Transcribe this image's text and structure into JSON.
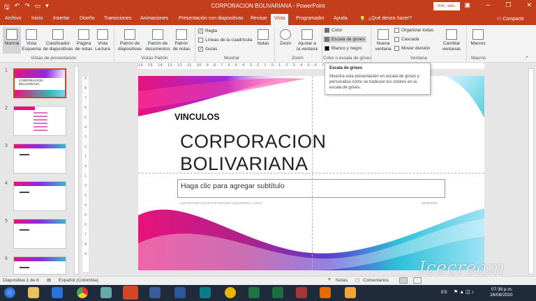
{
  "titlebar": {
    "title": "CORPORACION BOLIVARIANA  -  PowerPoint",
    "signin": "Inic. ses."
  },
  "tabs": [
    "Archivo",
    "Inicio",
    "Insertar",
    "Diseño",
    "Transiciones",
    "Animaciones",
    "Presentación con diapositivas",
    "Revisar",
    "Vista",
    "Programador",
    "Ayuda"
  ],
  "tell_me": "¿Qué desea hacer?",
  "share": "Compartir",
  "ribbon": {
    "groups": {
      "views": "Vistas de presentación",
      "patterns": "Vistas Patrón",
      "show": "Mostrar",
      "zoom": "Zoom",
      "color": "Color o escala de grises",
      "window": "Ventana",
      "macros": "Macros"
    },
    "normal": "Normal",
    "outline": "Vista\nEsquema",
    "sorter": "Clasificador\nde diapositivas",
    "notes_page": "Página\nde notas",
    "reading": "Vista\nLectura",
    "slide_master": "Patrón de\ndiapositivas",
    "handout_master": "Patrón de\ndocumentos",
    "notes_master": "Patrón\nde notas",
    "ruler": "Regla",
    "gridlines": "Líneas de la cuadrícula",
    "guides": "Guías",
    "notes": "Notas",
    "zoom": "Zoom",
    "fit": "Ajustar a\nla ventana",
    "color": "Color",
    "grayscale": "Escala de grises",
    "bw": "Blanco y negro",
    "new_window": "Nueva\nventana",
    "arrange": "Organizar todas",
    "cascade": "Cascada",
    "move_split": "Mover división",
    "switch": "Cambiar\nventanas",
    "macros": "Macros"
  },
  "tooltip": {
    "title": "Escala de grises",
    "body": "Muestra esta presentación en escala de grises y personaliza cómo se traducen los colores en la escala de grises."
  },
  "thumbs": [
    {
      "n": "1"
    },
    {
      "n": "2"
    },
    {
      "n": "3"
    },
    {
      "n": "4"
    },
    {
      "n": "5"
    },
    {
      "n": "6"
    }
  ],
  "ruler_text": "16 · 15 · 14 · 13 · 12 · 11 · 10 · 9 · 8 · 7 · 6 · 5 · 4 · 3 · 2 · 1 · 0 · 1 · 2 · 3 · 4 · 5 · 6 · 7 · 8 · 9 · 10 · 11 · 12 · 13 · 14 · 15 · 16",
  "slide": {
    "vinculos": "VINCULOS",
    "title": "CORPORACION\nBOLIVARIANA",
    "subtitle": "Haga clic para agregar subtítulo",
    "expositor": "EXPOSITOR DOCENTE EDISON IZQUIERDO LOPEZ",
    "date": "26/08/2020"
  },
  "status": {
    "slide": "Diapositiva 1 de 8",
    "language": "Español (Colombia)",
    "notes": "Notas",
    "comments": "Comentarios"
  },
  "taskbar": {
    "lang": "ES",
    "time": "07:38 p.m.",
    "date": "26/08/2020"
  },
  "watermark": "Icecream",
  "colors": {
    "accent": "#c43e1c",
    "taskbar": "#1f2a3a"
  }
}
